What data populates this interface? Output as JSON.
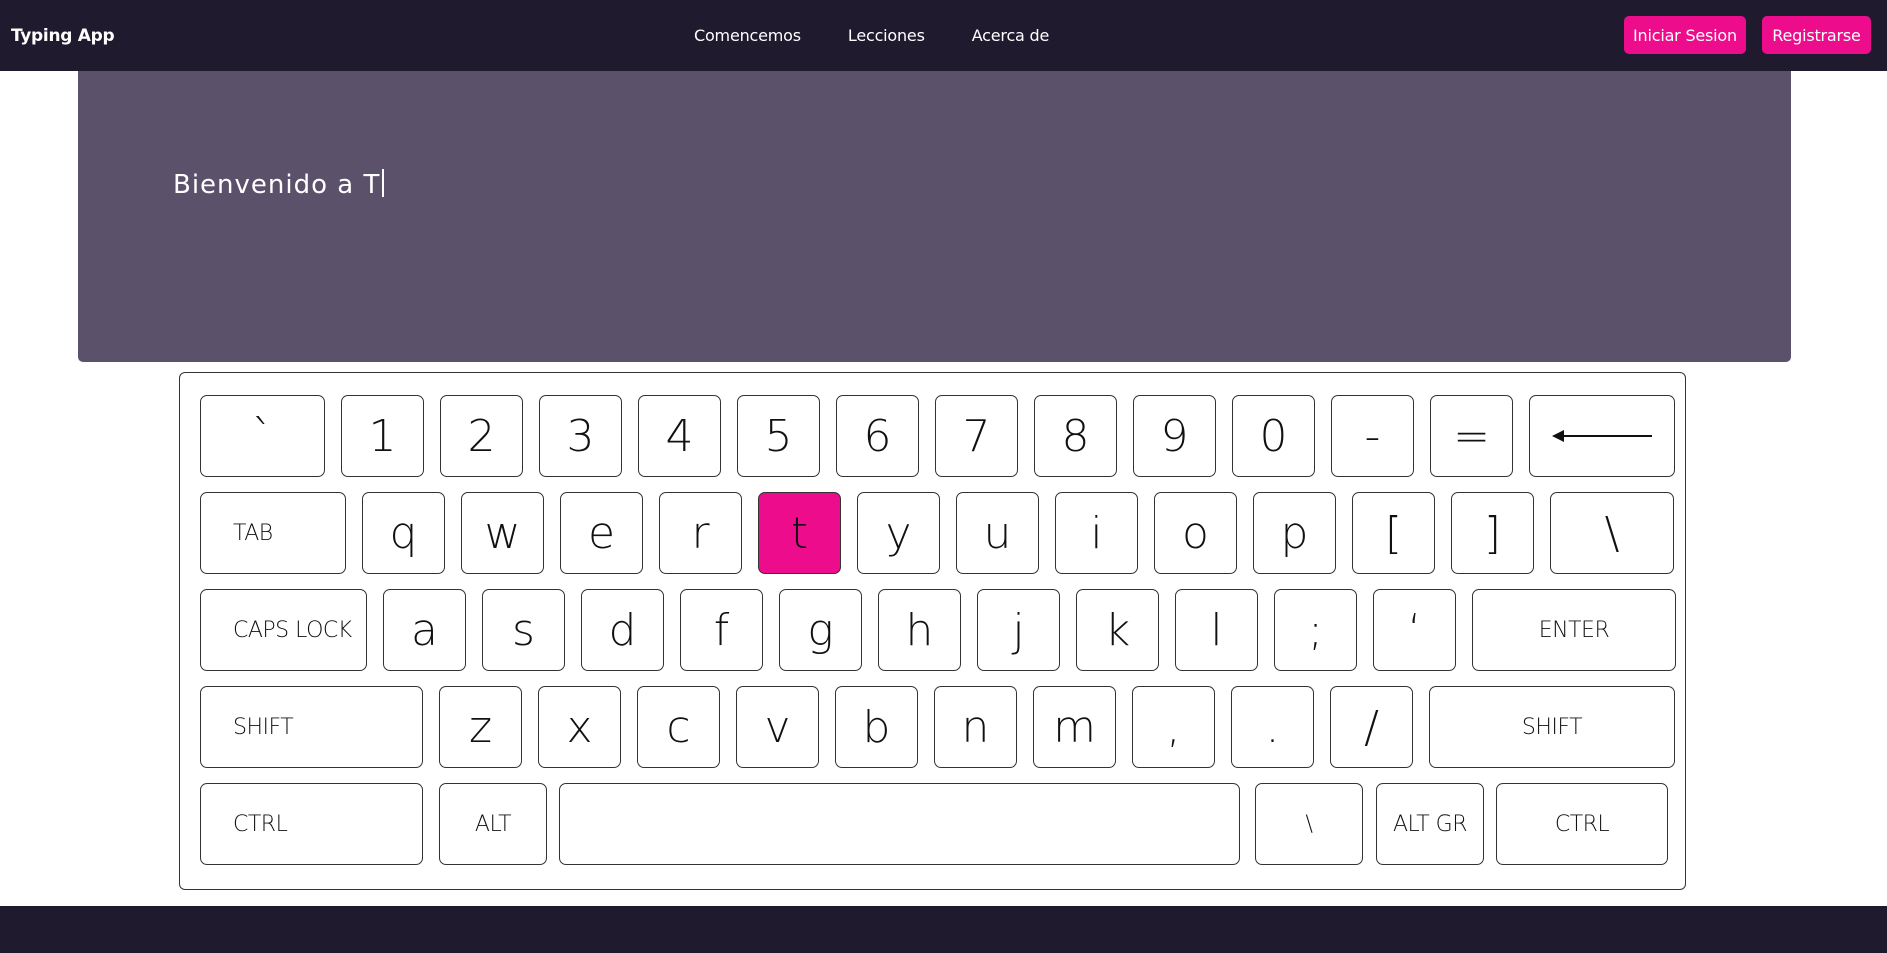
{
  "app": {
    "brand": "Typing App"
  },
  "nav": {
    "links": [
      "Comencemos",
      "Lecciones",
      "Acerca de"
    ],
    "login_label": "Iniciar Sesion",
    "register_label": "Registrarse"
  },
  "typing": {
    "typed_text": "Bienvenido a T"
  },
  "colors": {
    "navbar_bg": "#1f1a2e",
    "accent": "#ec0c8c",
    "panel_bg": "#5b516a"
  },
  "keyboard": {
    "active_key": "t",
    "rows": [
      [
        "`",
        "1",
        "2",
        "3",
        "4",
        "5",
        "6",
        "7",
        "8",
        "9",
        "0",
        "-",
        "=",
        "backspace-arrow"
      ],
      [
        "TAB",
        "q",
        "w",
        "e",
        "r",
        "t",
        "y",
        "u",
        "i",
        "o",
        "p",
        "[",
        "]",
        "\\"
      ],
      [
        "CAPS LOCK",
        "a",
        "s",
        "d",
        "f",
        "g",
        "h",
        "j",
        "k",
        "l",
        ";",
        "‘",
        "ENTER"
      ],
      [
        "SHIFT",
        "z",
        "x",
        "c",
        "v",
        "b",
        "n",
        "m",
        ",",
        ".",
        "/",
        "SHIFT"
      ],
      [
        "CTRL",
        "ALT",
        "",
        "\\",
        "ALT GR",
        "CTRL"
      ]
    ]
  }
}
